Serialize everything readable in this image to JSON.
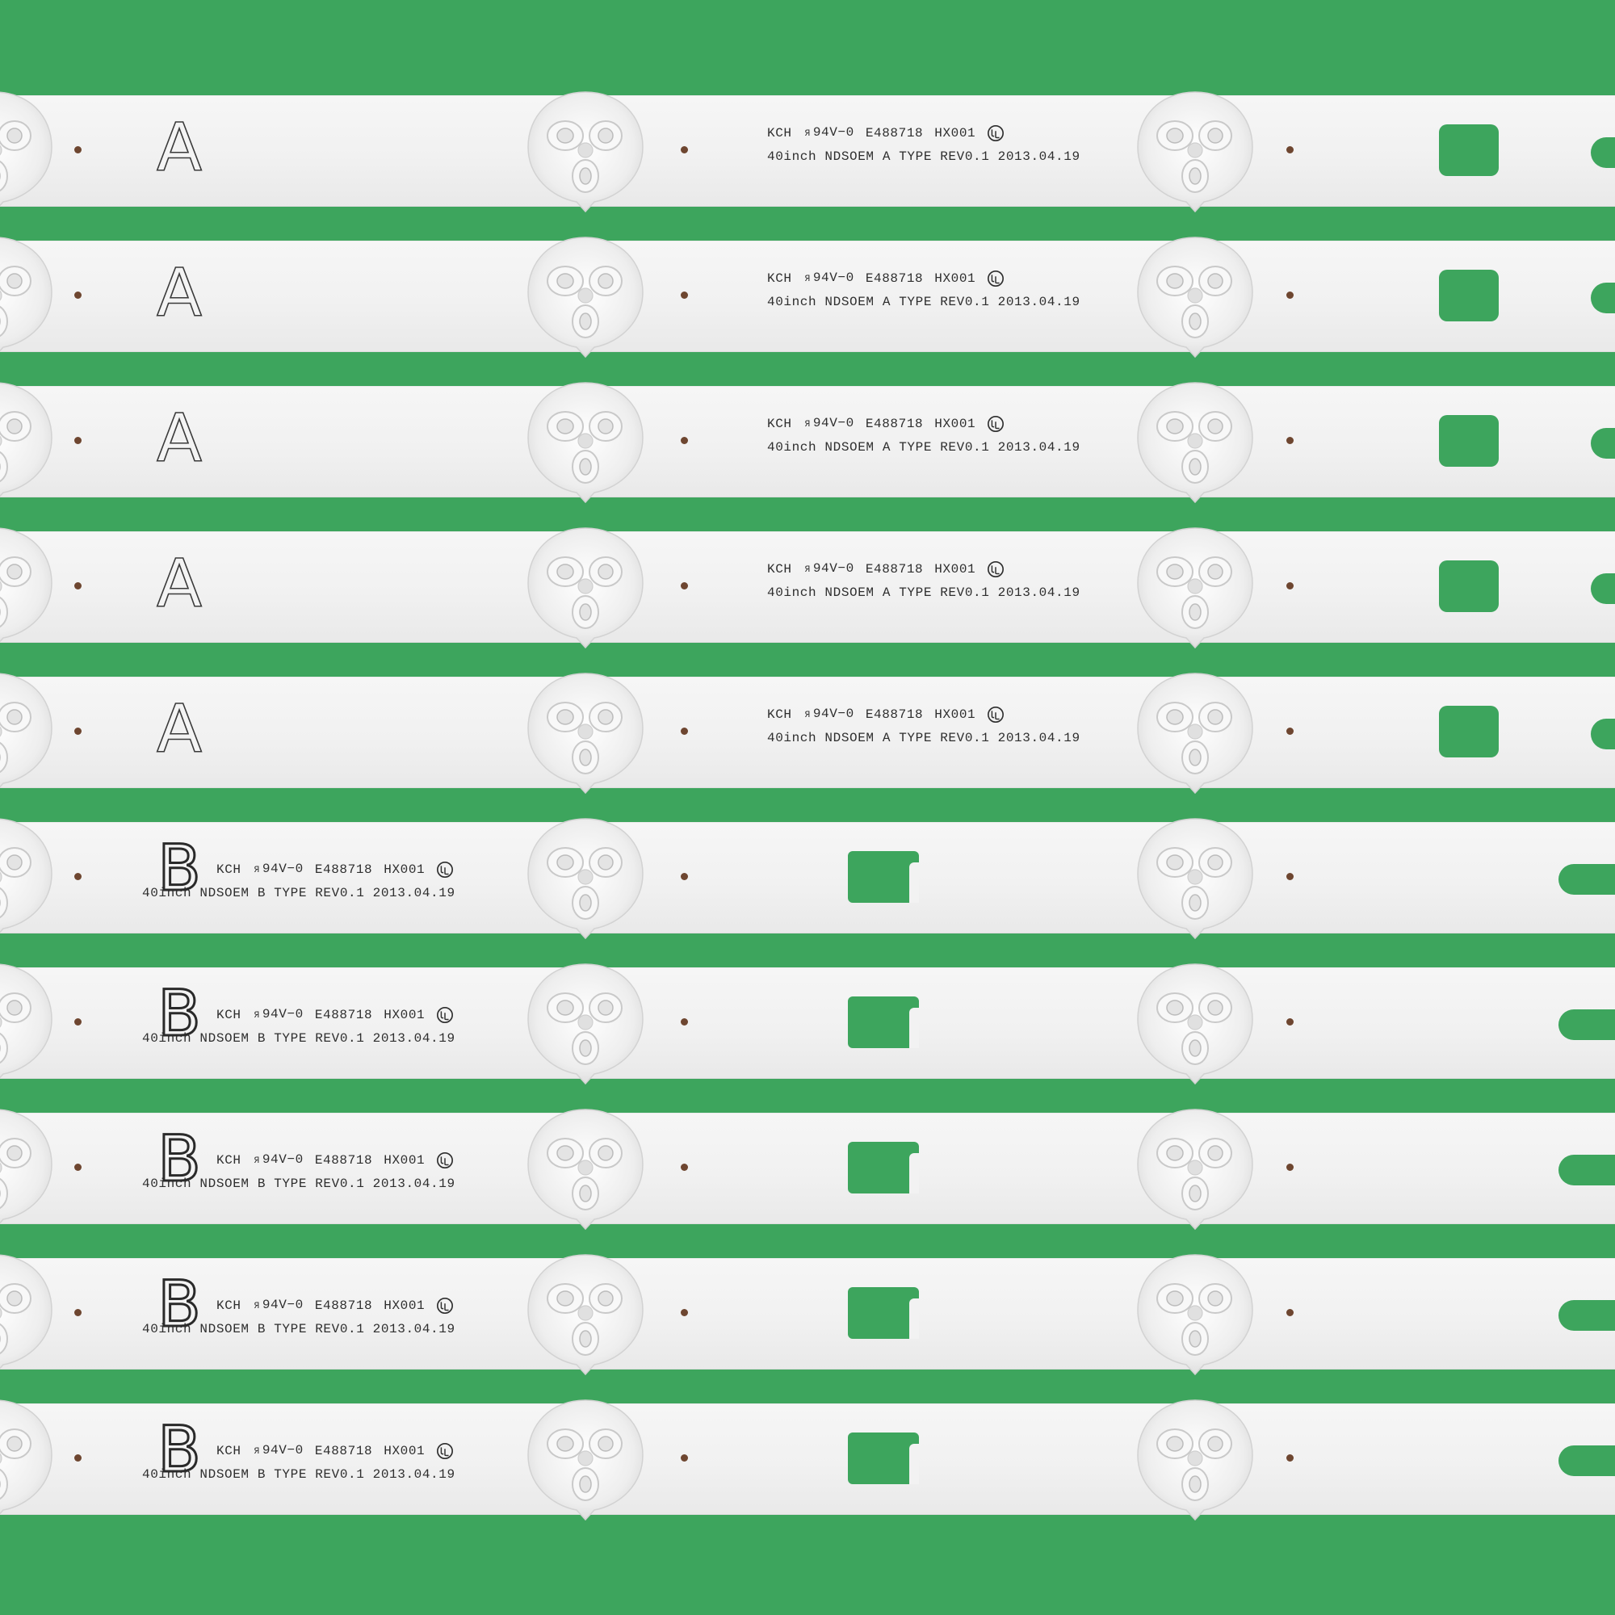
{
  "colors": {
    "background": "#3da55d",
    "strip": "#f2f2f2",
    "silkscreen": "#2e2e2e",
    "led_dot": "#6e4630"
  },
  "icons": {
    "lens": "led-lens-icon",
    "certification": "ul-recognized-mark-icon"
  },
  "strips": [
    {
      "letter": "A",
      "line1": {
        "kch": "KCH",
        "ul": "Я",
        "rating": "94V−0",
        "file": "E488718",
        "code": "HX001"
      },
      "line2": "40inch NDSOEM A TYPE REV0.1 2013.04.19"
    },
    {
      "letter": "A",
      "line1": {
        "kch": "KCH",
        "ul": "Я",
        "rating": "94V−0",
        "file": "E488718",
        "code": "HX001"
      },
      "line2": "40inch NDSOEM A TYPE REV0.1 2013.04.19"
    },
    {
      "letter": "A",
      "line1": {
        "kch": "KCH",
        "ul": "Я",
        "rating": "94V−0",
        "file": "E488718",
        "code": "HX001"
      },
      "line2": "40inch NDSOEM A TYPE REV0.1 2013.04.19"
    },
    {
      "letter": "A",
      "line1": {
        "kch": "KCH",
        "ul": "Я",
        "rating": "94V−0",
        "file": "E488718",
        "code": "HX001"
      },
      "line2": "40inch NDSOEM A TYPE REV0.1 2013.04.19"
    },
    {
      "letter": "A",
      "line1": {
        "kch": "KCH",
        "ul": "Я",
        "rating": "94V−0",
        "file": "E488718",
        "code": "HX001"
      },
      "line2": "40inch NDSOEM A TYPE REV0.1 2013.04.19"
    },
    {
      "letter": "B",
      "line1": {
        "kch": "KCH",
        "ul": "Я",
        "rating": "94V−0",
        "file": "E488718",
        "code": "HX001"
      },
      "line2": "40inch NDSOEM B TYPE REV0.1 2013.04.19"
    },
    {
      "letter": "B",
      "line1": {
        "kch": "KCH",
        "ul": "Я",
        "rating": "94V−0",
        "file": "E488718",
        "code": "HX001"
      },
      "line2": "40inch NDSOEM B TYPE REV0.1 2013.04.19"
    },
    {
      "letter": "B",
      "line1": {
        "kch": "KCH",
        "ul": "Я",
        "rating": "94V−0",
        "file": "E488718",
        "code": "HX001"
      },
      "line2": "40inch NDSOEM B TYPE REV0.1 2013.04.19"
    },
    {
      "letter": "B",
      "line1": {
        "kch": "KCH",
        "ul": "Я",
        "rating": "94V−0",
        "file": "E488718",
        "code": "HX001"
      },
      "line2": "40inch NDSOEM B TYPE REV0.1 2013.04.19"
    },
    {
      "letter": "B",
      "line1": {
        "kch": "KCH",
        "ul": "Я",
        "rating": "94V−0",
        "file": "E488718",
        "code": "HX001"
      },
      "line2": "40inch NDSOEM B TYPE REV0.1 2013.04.19"
    }
  ]
}
